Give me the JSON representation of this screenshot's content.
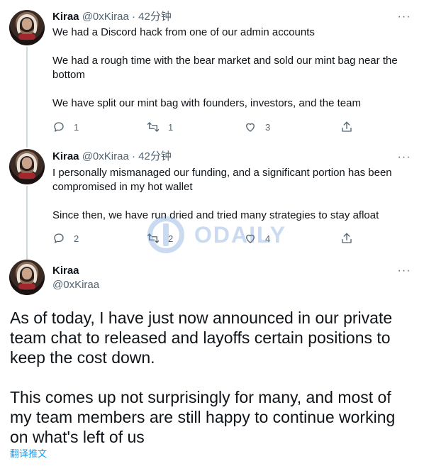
{
  "tweets": [
    {
      "name": "Kiraa",
      "handle": "@0xKiraa",
      "separator": "·",
      "time": "42分钟",
      "paragraphs": [
        "We had a Discord hack from one of our admin accounts",
        "We had a rough time with the bear market and sold our mint bag near the bottom",
        "We have split our mint bag with founders, investors, and the team"
      ],
      "replies": "1",
      "retweets": "1",
      "likes": "3"
    },
    {
      "name": "Kiraa",
      "handle": "@0xKiraa",
      "separator": "·",
      "time": "42分钟",
      "paragraphs": [
        "I personally mismanaged our funding, and a significant portion has been compromised in my hot wallet",
        "Since then, we have run dried and tried many strategies to stay afloat"
      ],
      "replies": "2",
      "retweets": "2",
      "likes": "4"
    }
  ],
  "main_tweet": {
    "name": "Kiraa",
    "handle": "@0xKiraa",
    "paragraphs": [
      "As of today, I have just now announced in our private team chat to released and layoffs certain positions to keep the cost down.",
      "This comes up not surprisingly for many, and most of my team members are still happy to continue working on what's left of us"
    ],
    "translate_label": "翻译推文"
  },
  "more_icon_text": "···",
  "watermark_text": "ODAILY",
  "icons": {
    "reply": "reply-icon",
    "retweet": "retweet-icon",
    "like": "heart-icon",
    "share": "share-icon",
    "more": "more-icon"
  }
}
